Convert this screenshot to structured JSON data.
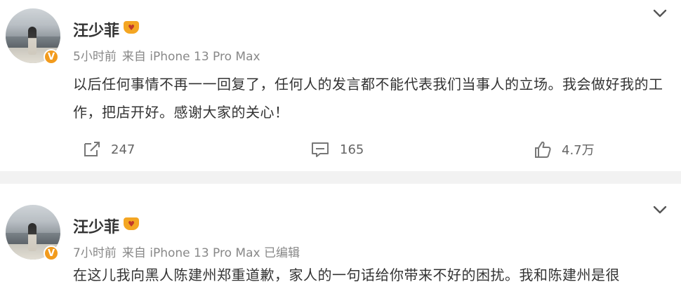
{
  "posts": [
    {
      "username": "汪少菲",
      "time": "5小时前",
      "source": "来自 iPhone 13 Pro Max",
      "content": "以后任何事情不再一一回复了，任何人的发言都不能代表我们当事人的立场。我会做好我的工作，把店开好。感谢大家的关心！",
      "reposts": "247",
      "comments": "165",
      "likes": "4.7万"
    },
    {
      "username": "汪少菲",
      "time": "7小时前",
      "source": "来自 iPhone 13 Pro Max 已编辑",
      "content": "在这儿我向黑人陈建州郑重道歉，家人的一句话给你带来不好的困扰。我和陈建州是很"
    }
  ],
  "verified_badge": "V",
  "colors": {
    "badge": "#f29b1d",
    "meta_text": "#888888",
    "body_text": "#333333",
    "divider": "#f2f2f2"
  },
  "icons": [
    "chevron-down-icon",
    "repost-icon",
    "comment-icon",
    "like-icon",
    "level-badge-icon",
    "verified-icon"
  ]
}
